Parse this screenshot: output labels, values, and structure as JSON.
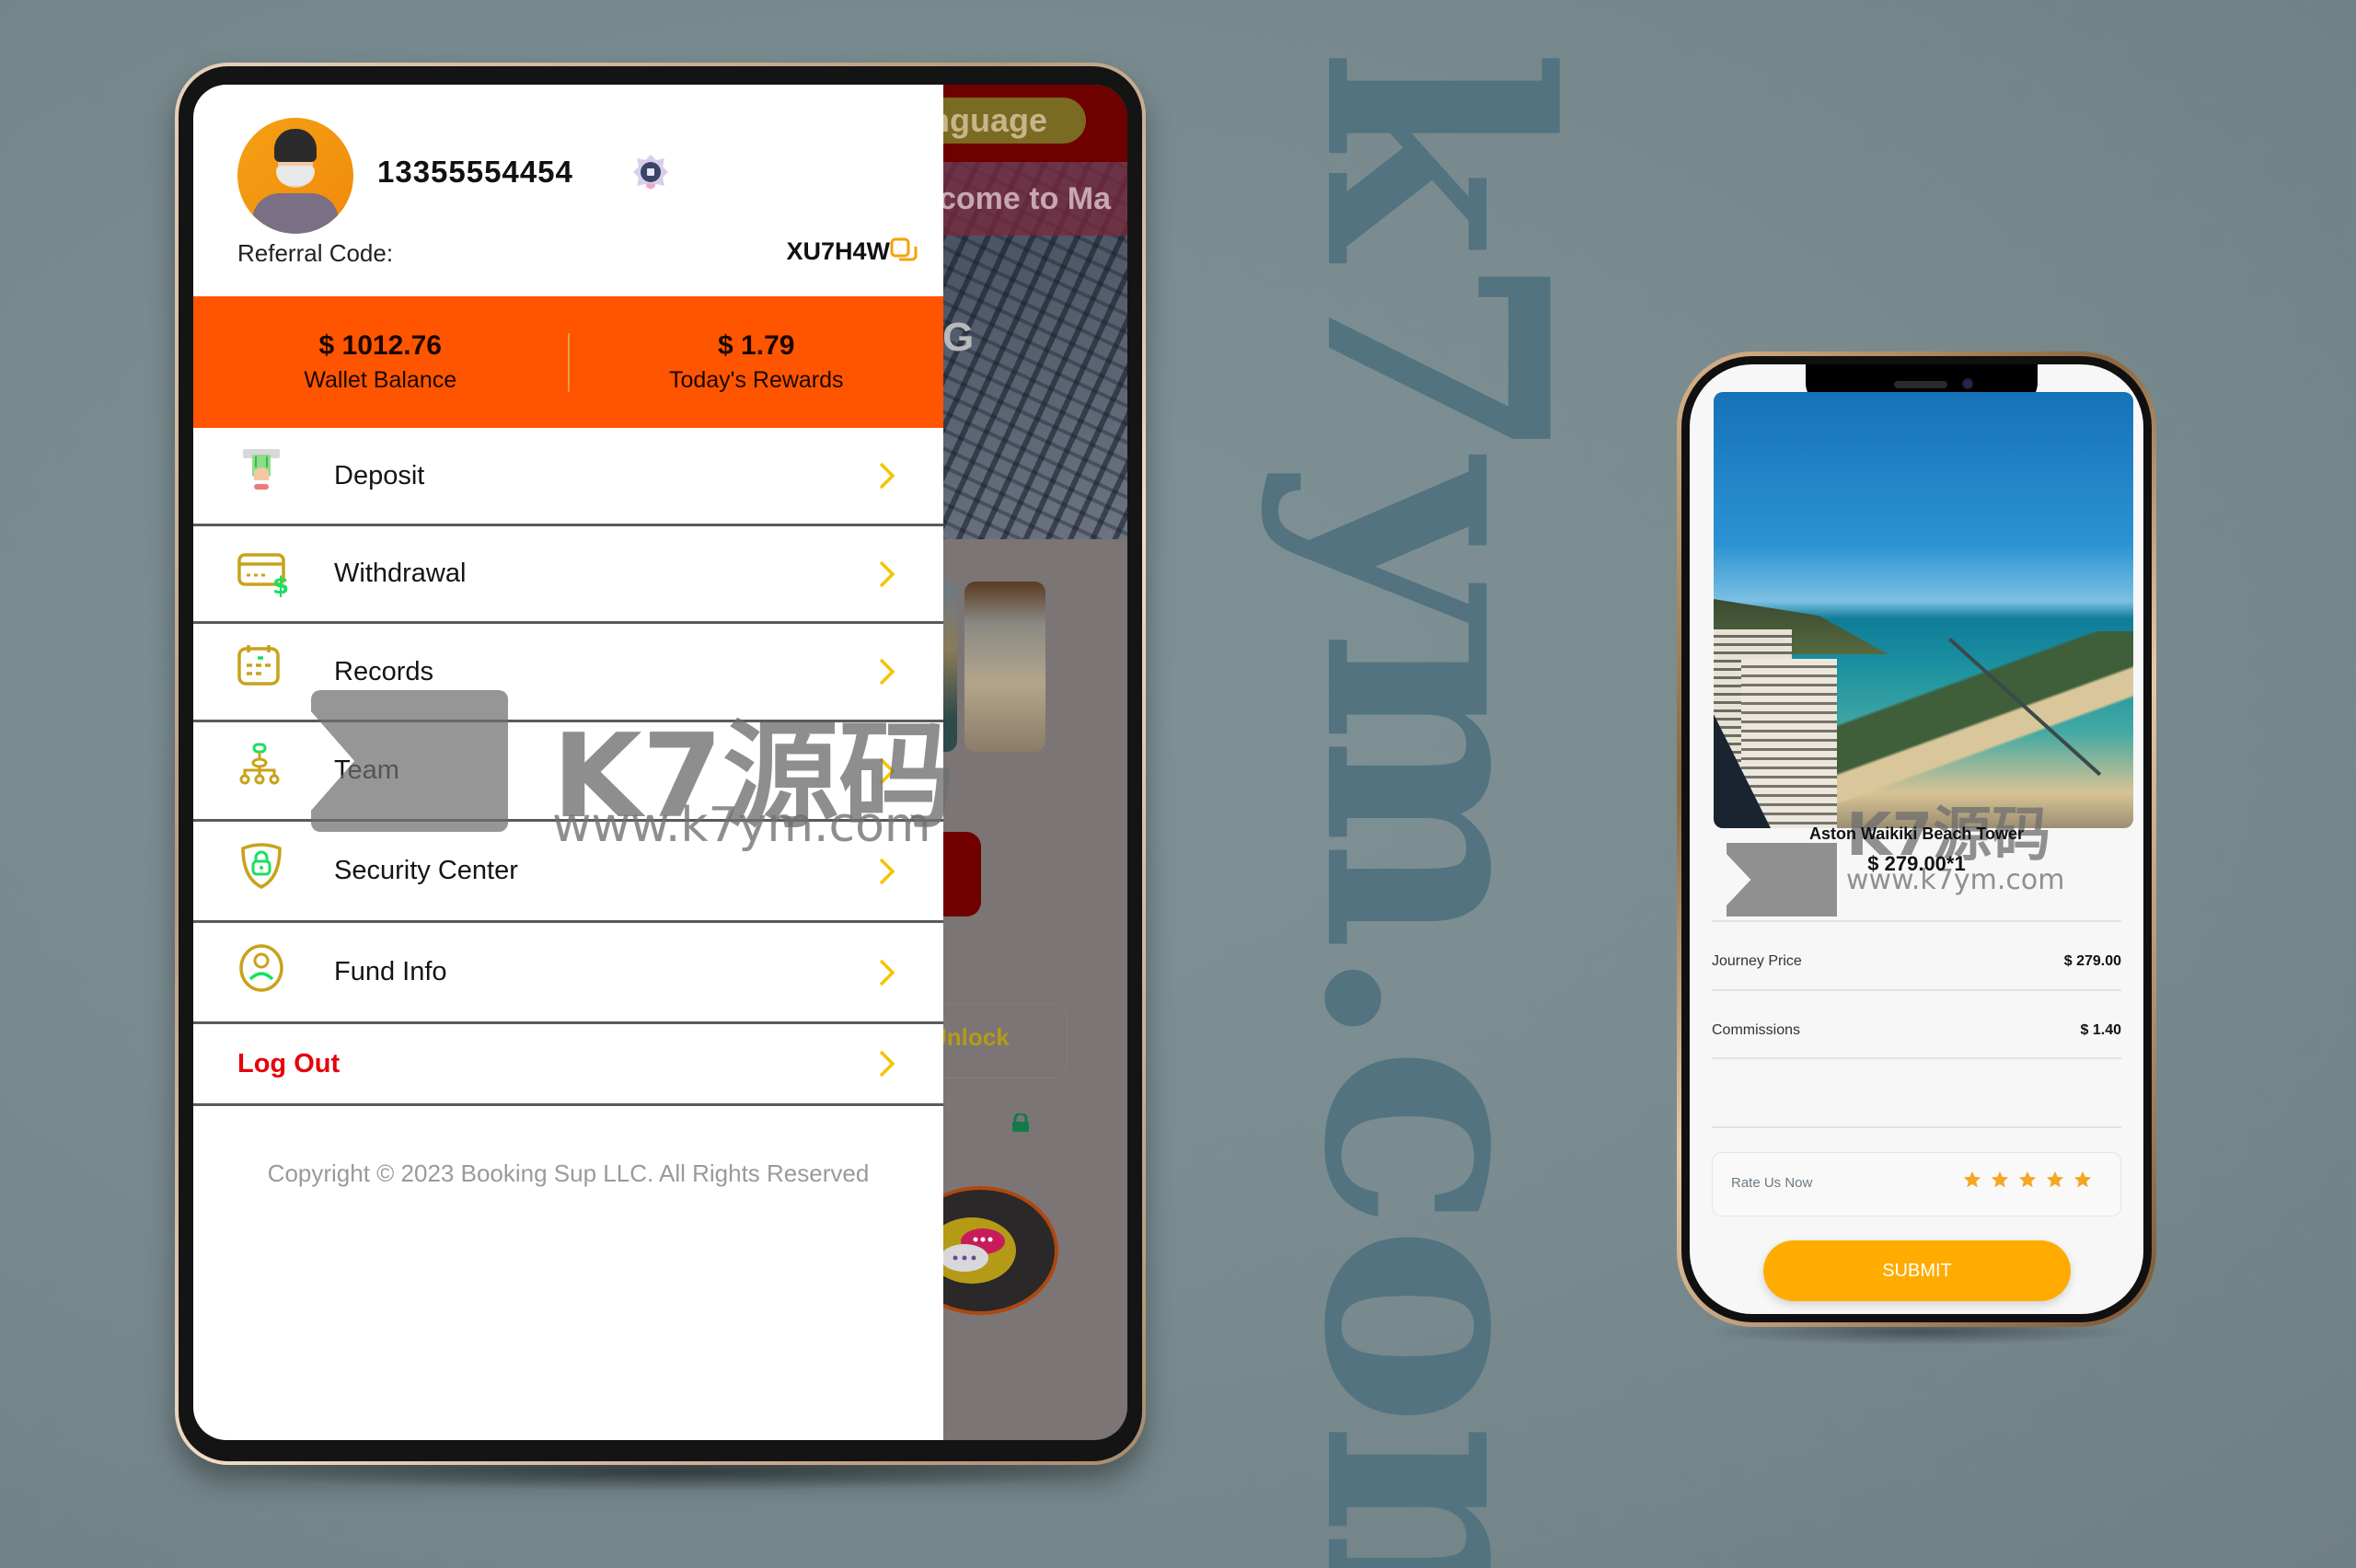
{
  "watermark": {
    "vertical_text": "k7ym.com",
    "brand": "K7源码",
    "url": "www.k7ym.com"
  },
  "tablet": {
    "background_app": {
      "language_button": "anguage",
      "welcome_text": "come to Ma",
      "hero_text": "ING",
      "unlock_label": "Unlock"
    },
    "drawer": {
      "username": "13355554454",
      "referral_label": "Referral Code:",
      "referral_code": "XU7H4W",
      "wallet_balance": {
        "amount": "$ 1012.76",
        "label": "Wallet Balance"
      },
      "todays_rewards": {
        "amount": "$ 1.79",
        "label": "Today's Rewards"
      },
      "menu": [
        {
          "label": "Deposit",
          "icon": "deposit-icon"
        },
        {
          "label": "Withdrawal",
          "icon": "withdrawal-card-icon"
        },
        {
          "label": "Records",
          "icon": "calendar-records-icon"
        },
        {
          "label": "Team",
          "icon": "team-hierarchy-icon"
        },
        {
          "label": "Security Center",
          "icon": "shield-lock-icon"
        },
        {
          "label": "Fund Info",
          "icon": "user-circle-icon"
        },
        {
          "label": "Log Out",
          "icon": ""
        }
      ],
      "copyright": "Copyright © 2023 Booking Sup LLC. All Rights Reserved"
    }
  },
  "phone": {
    "hotel_name": "Aston Waikiki Beach Tower",
    "price_qty": "$ 279.00*1",
    "rows": [
      {
        "label": "Journey Price",
        "value": "$ 279.00"
      },
      {
        "label": "Commissions",
        "value": "$ 1.40"
      }
    ],
    "rate_label": "Rate Us Now",
    "rating": {
      "value": 5,
      "max": 5
    },
    "submit_label": "SUBMIT"
  },
  "colors": {
    "accent_orange": "#ff5500",
    "chevron_yellow": "#f5c400",
    "icon_gold": "#c9a21a",
    "icon_green": "#19e060",
    "logout_red": "#e6000a",
    "submit_amber": "#ffab00",
    "star_amber": "#f5a623"
  }
}
